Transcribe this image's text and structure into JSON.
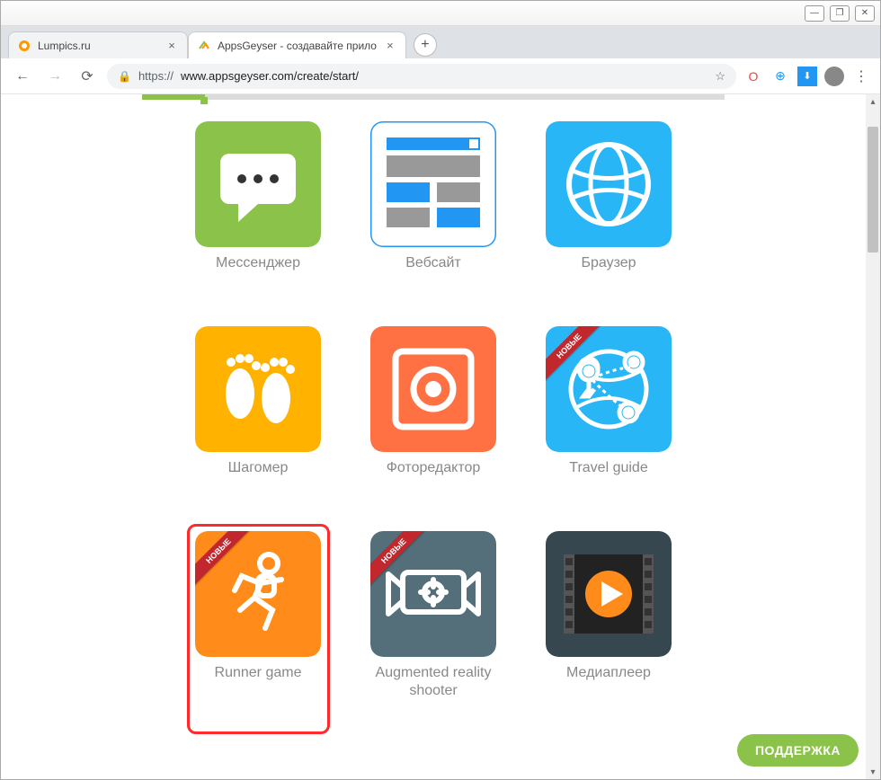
{
  "window": {
    "minimize": "—",
    "maximize": "❐",
    "close": "✕"
  },
  "tabs": [
    {
      "title": "Lumpics.ru",
      "active": false,
      "favicon": "orange"
    },
    {
      "title": "AppsGeyser - создавайте прило",
      "active": true,
      "favicon": "ag"
    }
  ],
  "nav": {
    "back": "←",
    "forward": "→",
    "reload": "⟳",
    "newtab": "+"
  },
  "address": {
    "lock": "🔒",
    "proto": "https://",
    "url": "www.appsgeyser.com/create/start/",
    "star": "☆"
  },
  "extensions": {
    "opera": "O",
    "globe": "⊕",
    "download": "⬇"
  },
  "menu": "⋮",
  "ribbon_label": "НОВЫЕ",
  "cards": [
    {
      "label": "Мессенджер",
      "icon": "messenger",
      "ribbon": false,
      "highlight": false
    },
    {
      "label": "Вебсайт",
      "icon": "website",
      "ribbon": false,
      "highlight": false
    },
    {
      "label": "Браузер",
      "icon": "browser",
      "ribbon": false,
      "highlight": false
    },
    {
      "label": "Шагомер",
      "icon": "pedometer",
      "ribbon": false,
      "highlight": false
    },
    {
      "label": "Фоторедактор",
      "icon": "photoeditor",
      "ribbon": false,
      "highlight": false
    },
    {
      "label": "Travel guide",
      "icon": "travel",
      "ribbon": true,
      "highlight": false
    },
    {
      "label": "Runner game",
      "icon": "runner",
      "ribbon": true,
      "highlight": true
    },
    {
      "label": "Augmented reality shooter",
      "icon": "ar",
      "ribbon": true,
      "highlight": false
    },
    {
      "label": "Медиаплеер",
      "icon": "mediaplayer",
      "ribbon": false,
      "highlight": false
    }
  ],
  "support": "ПОДДЕРЖКА",
  "scroll": {
    "up": "▴",
    "down": "▾"
  }
}
